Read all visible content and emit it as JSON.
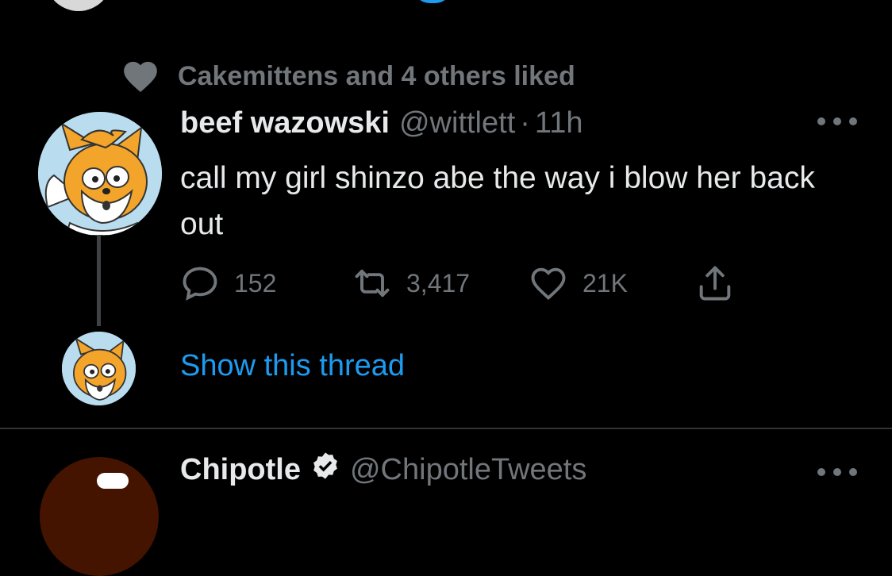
{
  "social_context": {
    "text": "Cakemittens and 4 others liked",
    "icon": "heart-filled-icon"
  },
  "tweet": {
    "author_name": "beef wazowski",
    "author_handle": "@wittlett",
    "separator": "·",
    "time": "11h",
    "text": "call my girl shinzo abe the way i blow her back out",
    "actions": {
      "replies": "152",
      "retweets": "3,417",
      "likes": "21K"
    },
    "more_icon": "more-horizontal-icon"
  },
  "show_thread": {
    "label": "Show this thread"
  },
  "next_tweet": {
    "author_name": "Chipotle",
    "author_handle": "@ChipotleTweets",
    "verified_icon": "verified-badge-icon"
  },
  "colors": {
    "background": "#000000",
    "text_primary": "#e7e9ea",
    "text_muted": "#71767b",
    "link": "#1d9bf0",
    "avatar_bg": "#b9dcef",
    "fox_orange": "#f3a42a"
  }
}
